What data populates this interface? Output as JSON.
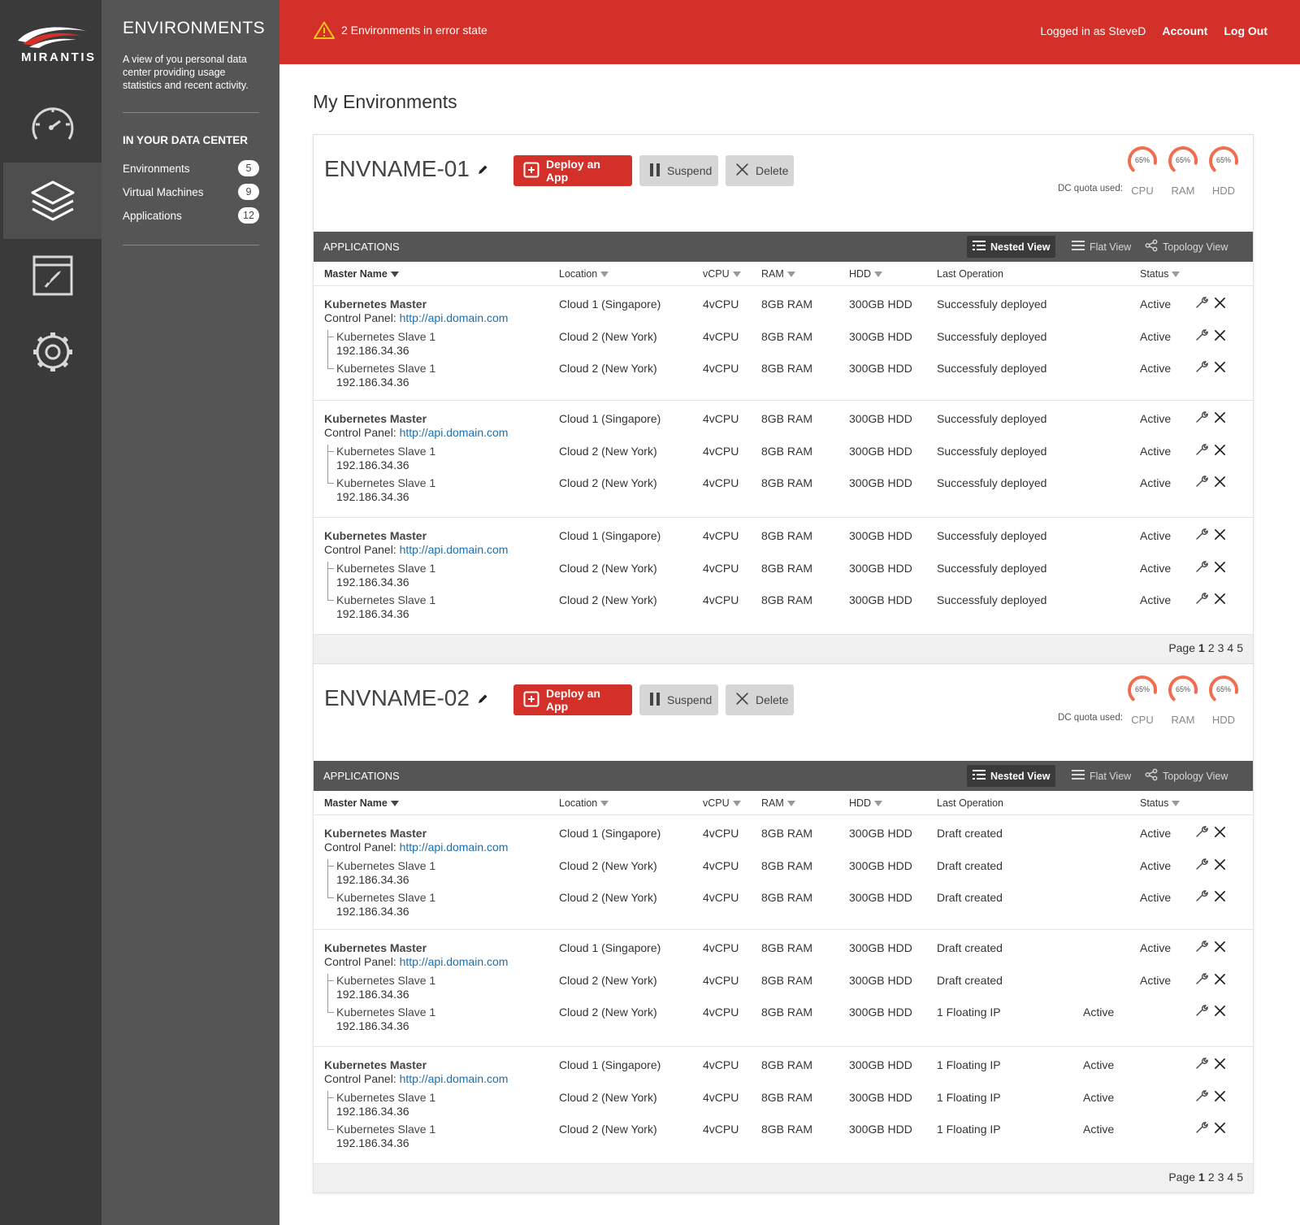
{
  "brand": {
    "wordmark": "MIRANTIS"
  },
  "colors": {
    "accent": "#d3302a",
    "rail": "#3a3a3a",
    "panel": "#555555",
    "link": "#1a6fb3",
    "gauge": "#f26d4f"
  },
  "rail": {
    "items": [
      {
        "icon": "dashboard-gauge-icon",
        "active": false
      },
      {
        "icon": "layers-icon",
        "active": true
      },
      {
        "icon": "app-window-rocket-icon",
        "active": false
      },
      {
        "icon": "settings-gear-icon",
        "active": false
      }
    ]
  },
  "sidepanel": {
    "title": "ENVIRONMENTS",
    "description": "A view of you personal data center providing usage statistics and recent activity.",
    "section": "IN YOUR DATA CENTER",
    "items": [
      {
        "label": "Environments",
        "count": "5"
      },
      {
        "label": "Virtual Machines",
        "count": "9"
      },
      {
        "label": "Applications",
        "count": "12"
      }
    ]
  },
  "topbar": {
    "alert": "2 Environments in error state",
    "logged_in": "Logged in as SteveD",
    "account": "Account",
    "logout": "Log Out"
  },
  "page": {
    "title": "My Environments"
  },
  "labels": {
    "deploy": "Deploy an App",
    "suspend": "Suspend",
    "delete": "Delete",
    "quota": "DC quota used:",
    "applications": "APPLICATIONS",
    "nested_view": "Nested View",
    "flat_view": "Flat View",
    "topology_view": "Topology View",
    "col_master": "Master Name",
    "col_location": "Location",
    "col_vcpu": "vCPU",
    "col_ram": "RAM",
    "col_hdd": "HDD",
    "col_last_op": "Last Operation",
    "col_status": "Status",
    "control_panel": "Control Panel:",
    "page": "Page",
    "pages": [
      "1",
      "2",
      "3",
      "4",
      "5"
    ],
    "current_page": "1"
  },
  "environments": [
    {
      "name": "ENVNAME-01",
      "gauges": [
        {
          "label": "CPU",
          "value": "65%",
          "fraction": 0.65
        },
        {
          "label": "RAM",
          "value": "65%",
          "fraction": 0.65
        },
        {
          "label": "HDD",
          "value": "65%",
          "fraction": 0.65
        }
      ],
      "groups": [
        {
          "master": {
            "name": "Kubernetes Master",
            "url": "http://api.domain.com",
            "location": "Cloud 1 (Singapore)",
            "vcpu": "4vCPU",
            "ram": "8GB RAM",
            "hdd": "300GB HDD",
            "op": "Successfuly deployed",
            "status": "Active",
            "status_col": "status"
          },
          "slaves": [
            {
              "name": "Kubernetes Slave 1",
              "ip": "192.186.34.36",
              "location": "Cloud 2 (New York)",
              "vcpu": "4vCPU",
              "ram": "8GB RAM",
              "hdd": "300GB HDD",
              "op": "Successfuly deployed",
              "status": "Active",
              "status_col": "status"
            },
            {
              "name": "Kubernetes Slave 1",
              "ip": "192.186.34.36",
              "location": "Cloud 2 (New York)",
              "vcpu": "4vCPU",
              "ram": "8GB RAM",
              "hdd": "300GB HDD",
              "op": "Successfuly deployed",
              "status": "Active",
              "status_col": "status"
            }
          ]
        },
        {
          "master": {
            "name": "Kubernetes Master",
            "url": "http://api.domain.com",
            "location": "Cloud 1 (Singapore)",
            "vcpu": "4vCPU",
            "ram": "8GB RAM",
            "hdd": "300GB HDD",
            "op": "Successfuly deployed",
            "status": "Active",
            "status_col": "status"
          },
          "slaves": [
            {
              "name": "Kubernetes Slave 1",
              "ip": "192.186.34.36",
              "location": "Cloud 2 (New York)",
              "vcpu": "4vCPU",
              "ram": "8GB RAM",
              "hdd": "300GB HDD",
              "op": "Successfuly deployed",
              "status": "Active",
              "status_col": "status"
            },
            {
              "name": "Kubernetes Slave 1",
              "ip": "192.186.34.36",
              "location": "Cloud 2 (New York)",
              "vcpu": "4vCPU",
              "ram": "8GB RAM",
              "hdd": "300GB HDD",
              "op": "Successfuly deployed",
              "status": "Active",
              "status_col": "status"
            }
          ]
        },
        {
          "master": {
            "name": "Kubernetes Master",
            "url": "http://api.domain.com",
            "location": "Cloud 1 (Singapore)",
            "vcpu": "4vCPU",
            "ram": "8GB RAM",
            "hdd": "300GB HDD",
            "op": "Successfuly deployed",
            "status": "Active",
            "status_col": "status"
          },
          "slaves": [
            {
              "name": "Kubernetes Slave 1",
              "ip": "192.186.34.36",
              "location": "Cloud 2 (New York)",
              "vcpu": "4vCPU",
              "ram": "8GB RAM",
              "hdd": "300GB HDD",
              "op": "Successfuly deployed",
              "status": "Active",
              "status_col": "status"
            },
            {
              "name": "Kubernetes Slave 1",
              "ip": "192.186.34.36",
              "location": "Cloud 2 (New York)",
              "vcpu": "4vCPU",
              "ram": "8GB RAM",
              "hdd": "300GB HDD",
              "op": "Successfuly deployed",
              "status": "Active",
              "status_col": "status"
            }
          ]
        }
      ]
    },
    {
      "name": "ENVNAME-02",
      "gauges": [
        {
          "label": "CPU",
          "value": "65%",
          "fraction": 0.65
        },
        {
          "label": "RAM",
          "value": "65%",
          "fraction": 0.65
        },
        {
          "label": "HDD",
          "value": "65%",
          "fraction": 0.65
        }
      ],
      "groups": [
        {
          "master": {
            "name": "Kubernetes Master",
            "url": "http://api.domain.com",
            "location": "Cloud 1 (Singapore)",
            "vcpu": "4vCPU",
            "ram": "8GB RAM",
            "hdd": "300GB HDD",
            "op": "Draft created",
            "status": "Active",
            "status_col": "status"
          },
          "slaves": [
            {
              "name": "Kubernetes Slave 1",
              "ip": "192.186.34.36",
              "location": "Cloud 2 (New York)",
              "vcpu": "4vCPU",
              "ram": "8GB RAM",
              "hdd": "300GB HDD",
              "op": "Draft created",
              "status": "Active",
              "status_col": "status"
            },
            {
              "name": "Kubernetes Slave 1",
              "ip": "192.186.34.36",
              "location": "Cloud 2 (New York)",
              "vcpu": "4vCPU",
              "ram": "8GB RAM",
              "hdd": "300GB HDD",
              "op": "Draft created",
              "status": "Active",
              "status_col": "status"
            }
          ]
        },
        {
          "master": {
            "name": "Kubernetes Master",
            "url": "http://api.domain.com",
            "location": "Cloud 1 (Singapore)",
            "vcpu": "4vCPU",
            "ram": "8GB RAM",
            "hdd": "300GB HDD",
            "op": "Draft created",
            "status": "Active",
            "status_col": "status"
          },
          "slaves": [
            {
              "name": "Kubernetes Slave 1",
              "ip": "192.186.34.36",
              "location": "Cloud 2 (New York)",
              "vcpu": "4vCPU",
              "ram": "8GB RAM",
              "hdd": "300GB HDD",
              "op": "Draft created",
              "status": "Active",
              "status_col": "status"
            },
            {
              "name": "Kubernetes Slave 1",
              "ip": "192.186.34.36",
              "location": "Cloud 2 (New York)",
              "vcpu": "4vCPU",
              "ram": "8GB RAM",
              "hdd": "300GB HDD",
              "op": "1 Floating IP",
              "status": "Active",
              "status_col": "shifted"
            }
          ]
        },
        {
          "master": {
            "name": "Kubernetes Master",
            "url": "http://api.domain.com",
            "location": "Cloud 1 (Singapore)",
            "vcpu": "4vCPU",
            "ram": "8GB RAM",
            "hdd": "300GB HDD",
            "op": "1 Floating IP",
            "status": "Active",
            "status_col": "shifted"
          },
          "slaves": [
            {
              "name": "Kubernetes Slave 1",
              "ip": "192.186.34.36",
              "location": "Cloud 2 (New York)",
              "vcpu": "4vCPU",
              "ram": "8GB RAM",
              "hdd": "300GB HDD",
              "op": "1 Floating IP",
              "status": "Active",
              "status_col": "shifted"
            },
            {
              "name": "Kubernetes Slave 1",
              "ip": "192.186.34.36",
              "location": "Cloud 2 (New York)",
              "vcpu": "4vCPU",
              "ram": "8GB RAM",
              "hdd": "300GB HDD",
              "op": "1 Floating IP",
              "status": "Active",
              "status_col": "shifted"
            }
          ]
        }
      ]
    }
  ]
}
